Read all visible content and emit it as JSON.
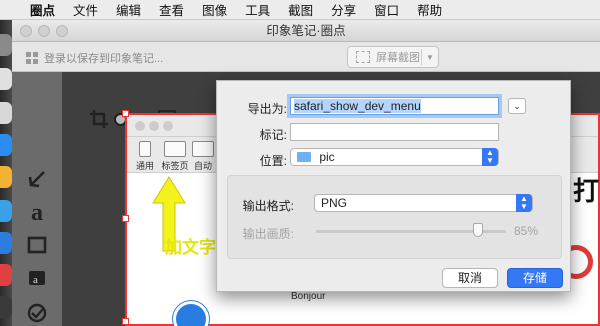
{
  "menubar": {
    "apple_icon": "apple-icon",
    "items": [
      "圈点",
      "文件",
      "编辑",
      "查看",
      "图像",
      "工具",
      "截图",
      "分享",
      "窗口",
      "帮助"
    ]
  },
  "window": {
    "title": "印象笔记·圈点",
    "login_text": "登录以保存到印象笔记...",
    "screenshot_button": "屏幕截图"
  },
  "editor": {
    "tools": [
      "crop-icon",
      "toggle-icon",
      "resize-icon",
      "arrow-icon",
      "text-icon",
      "rectangle-icon",
      "stamp-icon",
      "check-icon",
      "pixelate-icon"
    ]
  },
  "screenshot": {
    "tabs": [
      "通用",
      "标签页",
      "自动"
    ],
    "overlay_text": "加文字",
    "body_text": "Bonjour",
    "edge_text": "打"
  },
  "dialog": {
    "export_as_label": "导出为:",
    "export_as_value": "safari_show_dev_menu",
    "tags_label": "标记:",
    "tags_value": "",
    "location_label": "位置:",
    "location_value": "pic",
    "format_label": "输出格式:",
    "format_value": "PNG",
    "quality_label": "输出画质:",
    "quality_value": "85%",
    "quality_fraction": 0.85,
    "cancel_label": "取消",
    "save_label": "存储"
  },
  "colors": {
    "accent": "#3478f6",
    "selection_border": "#e33333",
    "arrow_yellow": "#f3f21d"
  }
}
